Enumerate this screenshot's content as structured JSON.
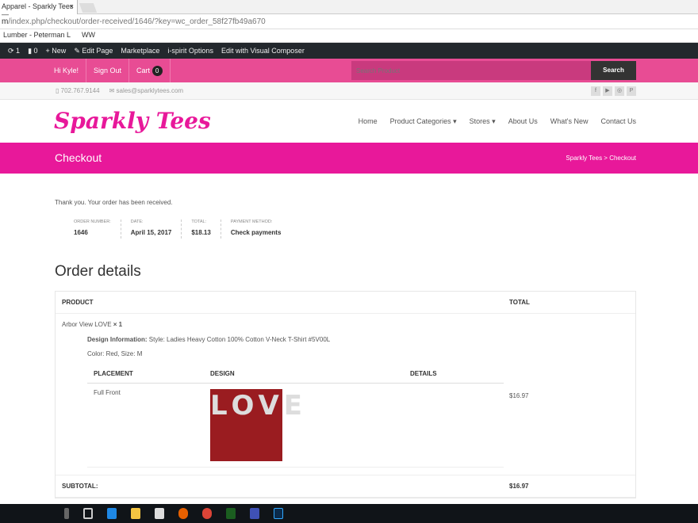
{
  "browser": {
    "tab_title": "Apparel - Sparkly Tees —",
    "tab_close": "×",
    "url_host": "m",
    "url_path": "/index.php/checkout/order-received/1646/?key=wc_order_58f27fb49a670",
    "bookmarks": [
      "Lumber - Peterman L",
      "WW"
    ]
  },
  "admin_bar": {
    "updates": "1",
    "comments": "0",
    "new": "New",
    "items": [
      "Edit Page",
      "Marketplace",
      "i-spirit Options",
      "Edit with Visual Composer"
    ]
  },
  "top_bar": {
    "greeting": "Hi Kyle!",
    "sign_out": "Sign Out",
    "cart": "Cart",
    "cart_count": "0",
    "search_placeholder": "Search Product",
    "search_button": "Search"
  },
  "contact": {
    "phone": "702.767.9144",
    "email": "sales@sparklytees.com",
    "social": [
      "f",
      "▶",
      "◎",
      "P"
    ]
  },
  "logo": "Sparkly Tees",
  "nav": [
    "Home",
    "Product Categories ▾",
    "Stores ▾",
    "About Us",
    "What's New",
    "Contact Us"
  ],
  "banner": {
    "title": "Checkout",
    "breadcrumb": "Sparkly Tees > Checkout"
  },
  "order": {
    "thanks": "Thank you. Your order has been received.",
    "meta": [
      {
        "label": "Order number:",
        "value": "1646"
      },
      {
        "label": "Date:",
        "value": "April 15, 2017"
      },
      {
        "label": "Total:",
        "value": "$18.13"
      },
      {
        "label": "Payment method:",
        "value": "Check payments"
      }
    ]
  },
  "details": {
    "title": "Order details",
    "col_product": "Product",
    "col_total": "Total",
    "item_name": "Arbor View LOVE",
    "item_qty": "× 1",
    "design_label": "Design Information:",
    "design_value": "Style: Ladies Heavy Cotton 100% Cotton V-Neck T-Shirt #5V00L",
    "color_size": "Color: Red, Size: M",
    "inner_headers": [
      "Placement",
      "Design",
      "Details"
    ],
    "placement": "Full Front",
    "design_text": "LOVE",
    "item_total": "$16.97",
    "subtotal_label": "Subtotal:",
    "subtotal_value": "$16.97"
  }
}
